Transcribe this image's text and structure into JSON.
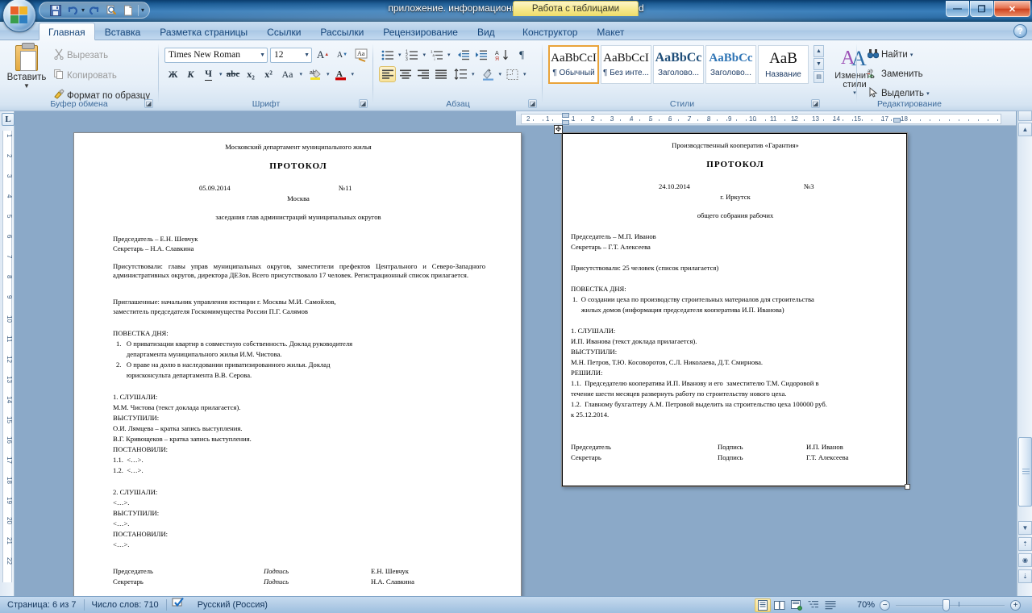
{
  "window": {
    "title": "приложение. информационные док.docx - Microsoft Word",
    "contextual_tab": "Работа с таблицами",
    "minimize": "—",
    "maximize": "❐",
    "close": "✕",
    "help": "?"
  },
  "quick_access": [
    {
      "name": "save-icon",
      "glyph": "💾"
    },
    {
      "name": "undo-icon",
      "glyph": "↶"
    },
    {
      "name": "undo-dropdown-icon",
      "glyph": "▾"
    },
    {
      "name": "redo-icon",
      "glyph": "↷"
    },
    {
      "name": "print-preview-icon",
      "glyph": "🔍"
    },
    {
      "name": "new-document-icon",
      "glyph": "🗋"
    },
    {
      "name": "customize-qat-icon",
      "glyph": "▾"
    }
  ],
  "tabs": [
    {
      "label": "Главная",
      "active": true
    },
    {
      "label": "Вставка",
      "active": false
    },
    {
      "label": "Разметка страницы",
      "active": false
    },
    {
      "label": "Ссылки",
      "active": false
    },
    {
      "label": "Рассылки",
      "active": false
    },
    {
      "label": "Рецензирование",
      "active": false
    },
    {
      "label": "Вид",
      "active": false
    }
  ],
  "contextual_tabs": [
    {
      "label": "Конструктор"
    },
    {
      "label": "Макет"
    }
  ],
  "ribbon": {
    "clipboard": {
      "group_label": "Буфер обмена",
      "paste": "Вставить",
      "paste_caret": "▼",
      "cut": "Вырезать",
      "copy": "Копировать",
      "format_painter": "Формат по образцу"
    },
    "font": {
      "group_label": "Шрифт",
      "font_name": "Times New Roman",
      "font_size": "12",
      "grow_font": "A",
      "shrink_font": "A",
      "clear_formatting": "Aa",
      "bold": "Ж",
      "italic": "К",
      "underline": "Ч",
      "underline_caret": "▾",
      "strikethrough": "abc",
      "subscript": "x₂",
      "superscript": "x²",
      "change_case": "Aa",
      "change_case_caret": "▾",
      "highlight": "ab",
      "highlight_caret": "▾",
      "font_color": "A",
      "font_color_caret": "▾"
    },
    "paragraph": {
      "group_label": "Абзац",
      "bullets": "☰",
      "bullets_caret": "▾",
      "numbering": "☰",
      "numbering_caret": "▾",
      "multilevel": "☰",
      "multilevel_caret": "▾",
      "decrease_indent": "⇤",
      "increase_indent": "⇥",
      "sort": "А↓",
      "show_marks": "¶",
      "align_left": "☰",
      "align_center": "☰",
      "align_right": "☰",
      "align_justify": "☰",
      "line_spacing": "↕",
      "line_spacing_caret": "▾",
      "shading": "▧",
      "shading_caret": "▾",
      "borders": "▣",
      "borders_caret": "▾"
    },
    "styles": {
      "group_label": "Стили",
      "items": [
        {
          "preview": "AaBbCcI",
          "label": "¶ Обычный",
          "selected": true
        },
        {
          "preview": "AaBbCcI",
          "label": "¶ Без инте...",
          "selected": false
        },
        {
          "preview": "AaBbCс",
          "label": "Заголово...",
          "selected": false
        },
        {
          "preview": "AaBbCc",
          "label": "Заголово...",
          "selected": false
        },
        {
          "preview": "АaB",
          "label": "Название",
          "selected": false
        }
      ],
      "change_styles": "Изменить стили",
      "change_styles_caret": "▾",
      "scroll_up": "▲",
      "scroll_down": "▼",
      "more": "▤"
    },
    "editing": {
      "group_label": "Редактирование",
      "find": "Найти",
      "find_caret": "▾",
      "replace": "Заменить",
      "select": "Выделить",
      "select_caret": "▾"
    }
  },
  "rulers": {
    "tab_selector": "L",
    "horizontal_ticks": [
      "2",
      "1",
      "1",
      "2",
      "3",
      "4",
      "5",
      "6",
      "7",
      "8",
      "9",
      "10",
      "11",
      "12",
      "13",
      "14",
      "15",
      "17",
      "18"
    ],
    "vertical_ticks": [
      "1",
      "2",
      "3",
      "4",
      "5",
      "6",
      "7",
      "8",
      "9",
      "10",
      "11",
      "12",
      "13",
      "14",
      "15",
      "16",
      "17",
      "18",
      "19",
      "20",
      "21",
      "22"
    ]
  },
  "document": {
    "page1": {
      "org": "Московский департамент муниципального жилья",
      "title": "ПРОТОКОЛ",
      "date": "05.09.2014",
      "number": "№11",
      "city": "Москва",
      "subject": "заседания глав администраций муниципальных округов",
      "chair": "Председатель – Е.Н. Шевчук",
      "secretary": "Секретарь – Н.А. Славкина",
      "present": "Присутствовали: главы управ муниципальных округов, заместители префектов Центрального и Северо-Западного административных округов, директора ДЕЗов. Всего присутствовало 17 человек. Регистрационный список прилагается.",
      "invited_1": "Приглашенные: начальник управления юстиции г. Москвы М.И. Самойлов,",
      "invited_2": "заместитель председателя Госкомимущества России П.Г. Салямов",
      "agenda_label": "ПОВЕСТКА ДНЯ:",
      "agenda": [
        "1.   О приватизации квартир в совместную собственность. Доклад руководителя",
        "      департамента муниципального жилья И.М. Чистова.",
        "2.   О праве на долю в наследовании приватизированного жилья. Доклад",
        "      юрисконсульта департамента В.В. Серова."
      ],
      "body": [
        "1. СЛУШАЛИ:",
        "М.М. Чистова (текст доклада прилагается).",
        "ВЫСТУПИЛИ:",
        "О.И. Лямцева – кратка запись выступления.",
        "В.Г. Кривощеков – кратка запись выступления.",
        "ПОСТАНОВИЛИ:",
        "1.1.  <…>.",
        "1.2.  <…>."
      ],
      "body2": [
        "2. СЛУШАЛИ:",
        "<…>.",
        "ВЫСТУПИЛИ:",
        "<…>.",
        "ПОСТАНОВИЛИ:",
        "<…>."
      ],
      "sign": [
        {
          "role": "Председатель",
          "sign": "Подпись",
          "name": "Е.Н. Шевчук"
        },
        {
          "role": "Секретарь",
          "sign": "Подпись",
          "name": "Н.А. Славкина"
        }
      ]
    },
    "page2": {
      "org": "Производственный кооператив «Гарантия»",
      "title": "ПРОТОКОЛ",
      "date": "24.10.2014",
      "number": "№3",
      "city": "г. Иркутск",
      "subject": "общего собрания рабочих",
      "chair": "Председатель – М.П. Иванов",
      "secretary": "Секретарь – Г.Т. Алексеева",
      "present": "Присутствовали: 25 человек (список прилагается)",
      "agenda_label": "ПОВЕСТКА ДНЯ:",
      "agenda": [
        "1.  О создании цеха по производству строительных материалов для строительства",
        "     жилых домов (информация председателя кооператива И.П. Иванова)"
      ],
      "body": [
        "1. СЛУШАЛИ:",
        "И.П. Иванова (текст доклада прилагается).",
        "ВЫСТУПИЛИ:",
        "М.Н. Петров, Т.Ю. Косоворотов, С.Л. Николаева, Д.Т. Смирнова.",
        "РЕШИЛИ:",
        "1.1.  Председателю кооператива И.П. Иванову и его  заместителю Т.М. Сидоровой в",
        "течение шести месяцев развернуть работу по строительству нового цеха.",
        "1.2.  Главному бухгалтеру А.М. Петровой выделить на строительство цеха 100000 руб.",
        "к 25.12.2014."
      ],
      "sign": [
        {
          "role": "Председатель",
          "sign": "Подпись",
          "name": "И.П. Иванов"
        },
        {
          "role": "Секретарь",
          "sign": "Подпись",
          "name": "Г.Т. Алексеева"
        }
      ]
    }
  },
  "status_bar": {
    "page": "Страница: 6 из 7",
    "words": "Число слов: 710",
    "proofing_icon": "spelling-check-icon",
    "language": "Русский (Россия)",
    "zoom": "70%",
    "zoom_out": "−",
    "zoom_in": "+",
    "views": [
      {
        "name": "print-layout-view",
        "glyph": "▤",
        "active": true
      },
      {
        "name": "full-screen-reading-view",
        "glyph": "▥",
        "active": false
      },
      {
        "name": "web-layout-view",
        "glyph": "▦",
        "active": false
      },
      {
        "name": "outline-view",
        "glyph": "▧",
        "active": false
      },
      {
        "name": "draft-view",
        "glyph": "▨",
        "active": false
      }
    ]
  },
  "colors": {
    "accent": "#2b6ca6",
    "ribbon_bg": "#e6eff8",
    "contextual": "#f6e98c",
    "style_selected": "#e9a33a"
  }
}
